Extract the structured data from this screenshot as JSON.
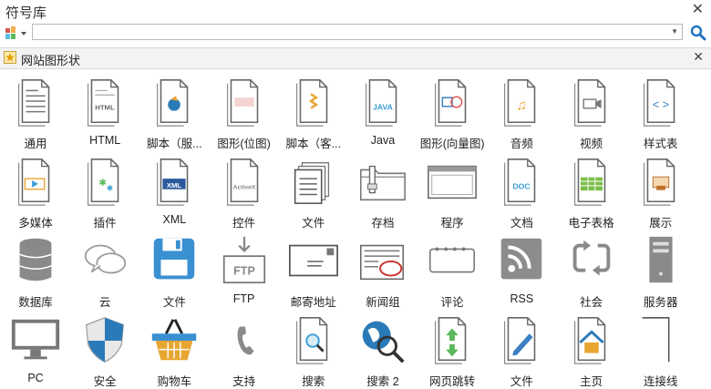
{
  "window": {
    "title": "符号库"
  },
  "search": {
    "value": "",
    "placeholder": ""
  },
  "library": {
    "name": "网站图形状"
  },
  "shapes": [
    {
      "label": "通用",
      "icon": "document-icon"
    },
    {
      "label": "HTML",
      "icon": "html-file-icon"
    },
    {
      "label": "脚本（服...",
      "icon": "server-script-icon"
    },
    {
      "label": "图形(位图)",
      "icon": "bitmap-icon"
    },
    {
      "label": "脚本（客...",
      "icon": "client-script-icon"
    },
    {
      "label": "Java",
      "icon": "java-file-icon"
    },
    {
      "label": "图形(向量图)",
      "icon": "vector-icon"
    },
    {
      "label": "音频",
      "icon": "audio-file-icon"
    },
    {
      "label": "视频",
      "icon": "video-file-icon"
    },
    {
      "label": "样式表",
      "icon": "stylesheet-icon"
    },
    {
      "label": "多媒体",
      "icon": "multimedia-icon"
    },
    {
      "label": "插件",
      "icon": "plugin-icon"
    },
    {
      "label": "XML",
      "icon": "xml-file-icon"
    },
    {
      "label": "控件",
      "icon": "activex-icon"
    },
    {
      "label": "文件",
      "icon": "files-stack-icon"
    },
    {
      "label": "存档",
      "icon": "archive-folder-icon"
    },
    {
      "label": "程序",
      "icon": "program-window-icon"
    },
    {
      "label": "文档",
      "icon": "doc-file-icon"
    },
    {
      "label": "电子表格",
      "icon": "spreadsheet-icon"
    },
    {
      "label": "展示",
      "icon": "presentation-icon"
    },
    {
      "label": "数据库",
      "icon": "database-icon"
    },
    {
      "label": "云",
      "icon": "cloud-chat-icon"
    },
    {
      "label": "文件",
      "icon": "floppy-disk-icon"
    },
    {
      "label": "FTP",
      "icon": "ftp-icon"
    },
    {
      "label": "邮寄地址",
      "icon": "envelope-icon"
    },
    {
      "label": "新闻组",
      "icon": "newsgroup-icon"
    },
    {
      "label": "评论",
      "icon": "comment-icon"
    },
    {
      "label": "RSS",
      "icon": "rss-icon"
    },
    {
      "label": "社会",
      "icon": "social-cycle-icon"
    },
    {
      "label": "服务器",
      "icon": "server-tower-icon"
    },
    {
      "label": "PC",
      "icon": "monitor-icon"
    },
    {
      "label": "安全",
      "icon": "security-shield-icon"
    },
    {
      "label": "购物车",
      "icon": "shopping-basket-icon"
    },
    {
      "label": "支持",
      "icon": "phone-handset-icon"
    },
    {
      "label": "搜索",
      "icon": "search-document-icon"
    },
    {
      "label": "搜索 2",
      "icon": "globe-search-icon"
    },
    {
      "label": "网页跳转",
      "icon": "page-redirect-icon"
    },
    {
      "label": "文件",
      "icon": "edit-file-icon"
    },
    {
      "label": "主页",
      "icon": "home-page-icon"
    },
    {
      "label": "连接线",
      "icon": "connector-line-icon"
    }
  ],
  "colors": {
    "accent": "#1e73be",
    "line": "#555555",
    "libbar": "#f3f3f3"
  }
}
